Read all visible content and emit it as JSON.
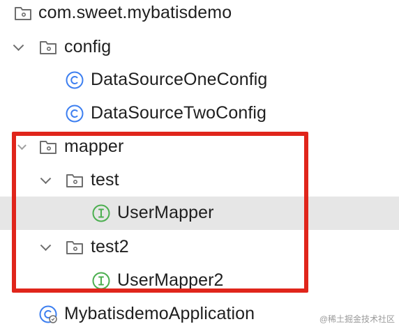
{
  "tree": {
    "package": {
      "label": "com.sweet.mybatisdemo"
    },
    "config": {
      "label": "config"
    },
    "config_children": [
      {
        "label": "DataSourceOneConfig"
      },
      {
        "label": "DataSourceTwoConfig"
      }
    ],
    "mapper": {
      "label": "mapper"
    },
    "test": {
      "label": "test"
    },
    "usermapper": {
      "label": "UserMapper"
    },
    "test2": {
      "label": "test2"
    },
    "usermapper2": {
      "label": "UserMapper2"
    },
    "application": {
      "label": "MybatisdemoApplication"
    }
  },
  "colors": {
    "class_icon": "#3d7ff0",
    "interface_icon": "#4caf50",
    "folder_icon": "#6e6e6e",
    "highlight": "#e0251b",
    "selected_row": "#e6e6e6"
  },
  "watermark": "@稀土掘金技术社区"
}
